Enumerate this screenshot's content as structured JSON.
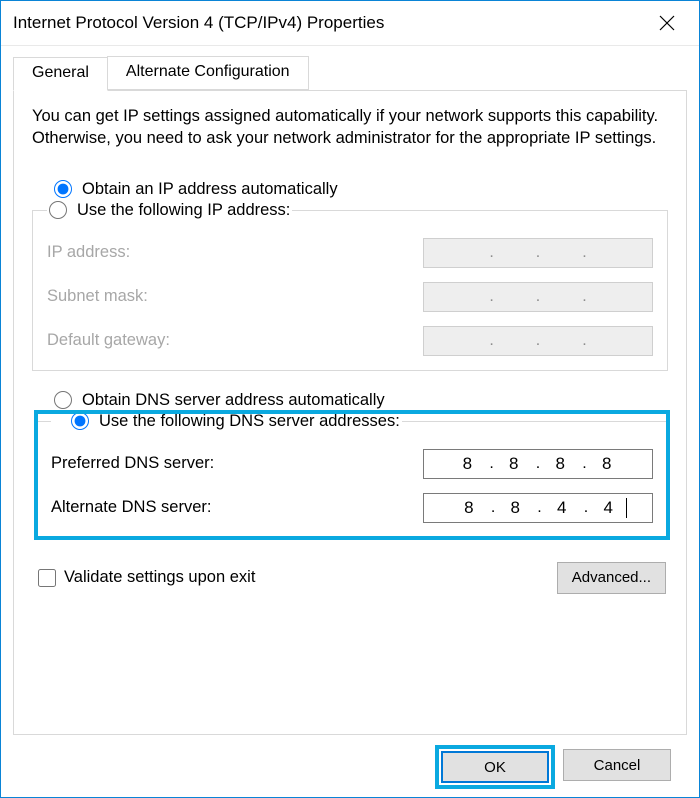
{
  "window": {
    "title": "Internet Protocol Version 4 (TCP/IPv4) Properties"
  },
  "tabs": {
    "general": "General",
    "alternate": "Alternate Configuration"
  },
  "description": "You can get IP settings assigned automatically if your network supports this capability. Otherwise, you need to ask your network administrator for the appropriate IP settings.",
  "ip": {
    "auto_label": "Obtain an IP address automatically",
    "manual_label": "Use the following IP address:",
    "address_label": "IP address:",
    "subnet_label": "Subnet mask:",
    "gateway_label": "Default gateway:"
  },
  "dns": {
    "auto_label": "Obtain DNS server address automatically",
    "manual_label": "Use the following DNS server addresses:",
    "preferred_label": "Preferred DNS server:",
    "alternate_label": "Alternate DNS server:",
    "preferred": {
      "o1": "8",
      "o2": "8",
      "o3": "8",
      "o4": "8"
    },
    "alternate": {
      "o1": "8",
      "o2": "8",
      "o3": "4",
      "o4": "4"
    }
  },
  "validate_label": "Validate settings upon exit",
  "buttons": {
    "advanced": "Advanced...",
    "ok": "OK",
    "cancel": "Cancel"
  }
}
